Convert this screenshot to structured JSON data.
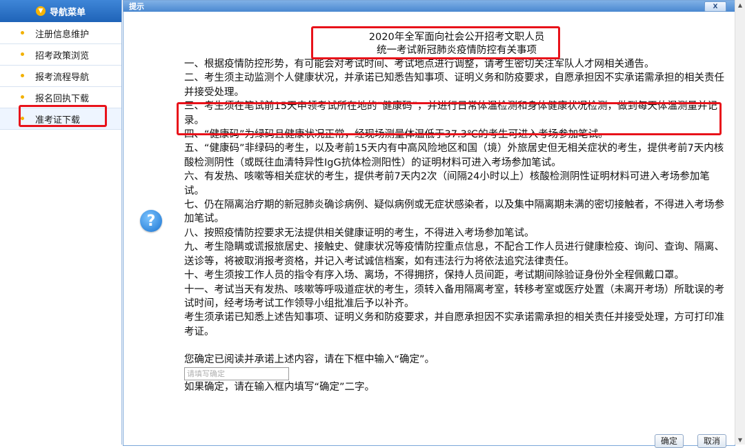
{
  "sidebar": {
    "header": "导航菜单",
    "items": [
      {
        "label": "注册信息维护"
      },
      {
        "label": "招考政策浏览"
      },
      {
        "label": "报考流程导航"
      },
      {
        "label": "报名回执下载"
      },
      {
        "label": "准考证下载"
      }
    ]
  },
  "dialog": {
    "title": "提示",
    "close_label": "X",
    "notice_title_line1": "2020年全军面向社会公开招考文职人员",
    "notice_title_line2": "统一考试新冠肺炎疫情防控有关事项",
    "paragraphs": [
      "一、根据疫情防控形势，有可能会对考试时间、考试地点进行调整，请考生密切关注军队人才网相关通告。",
      "二、考生须主动监测个人健康状况，并承诺已知悉告知事项、证明义务和防疫要求，自愿承担因不实承诺需承担的相关责任并接受处理。",
      "三、考生须在笔试前15天申领考试所在地的“健康码”，并进行日常体温检测和身体健康状况检测，做到每天体温测量并记录。",
      "四、“健康码”为绿码且健康状况正常，经现场测量体温低于37.3℃的考生可进入考场参加笔试。",
      "五、“健康码”非绿码的考生，以及考前15天内有中高风险地区和国（境）外旅居史但无相关症状的考生，提供考前7天内核酸检测阴性（或既往血清特异性IgG抗体检测阳性）的证明材料可进入考场参加笔试。",
      "六、有发热、咳嗽等相关症状的考生，提供考前7天内2次（间隔24小时以上）核酸检测阴性证明材料可进入考场参加笔试。",
      "七、仍在隔离治疗期的新冠肺炎确诊病例、疑似病例或无症状感染者，以及集中隔离期未满的密切接触者，不得进入考场参加笔试。",
      "八、按照疫情防控要求无法提供相关健康证明的考生，不得进入考场参加笔试。",
      "九、考生隐瞒或谎报旅居史、接触史、健康状况等疫情防控重点信息，不配合工作人员进行健康检疫、询问、查询、隔离、送诊等，将被取消报考资格，并记入考试诚信档案，如有违法行为将依法追究法律责任。",
      "十、考生须按工作人员的指令有序入场、离场，不得拥挤，保持人员间距，考试期间除验证身份外全程佩戴口罩。",
      "十一、考试当天有发热、咳嗽等呼吸道症状的考生，须转入备用隔离考室，转移考室或医疗处置（未离开考场）所耽误的考试时间，经考场考试工作领导小组批准后予以补齐。",
      "考生须承诺已知悉上述告知事项、证明义务和防疫要求，并自愿承担因不实承诺需承担的相关责任并接受处理，方可打印准考证。"
    ],
    "confirm_prompt": "您确定已阅读并承诺上述内容，请在下框中输入“确定”。",
    "confirm_placeholder": "请填写确定",
    "confirm_hint": "如果确定，请在输入框内填写“确定”二字。",
    "ok_label": "确定",
    "cancel_label": "取消"
  },
  "colors": {
    "header_blue": "#1f63b8",
    "highlight_red": "#e8121a",
    "bullet_yellow": "#f2b000"
  }
}
